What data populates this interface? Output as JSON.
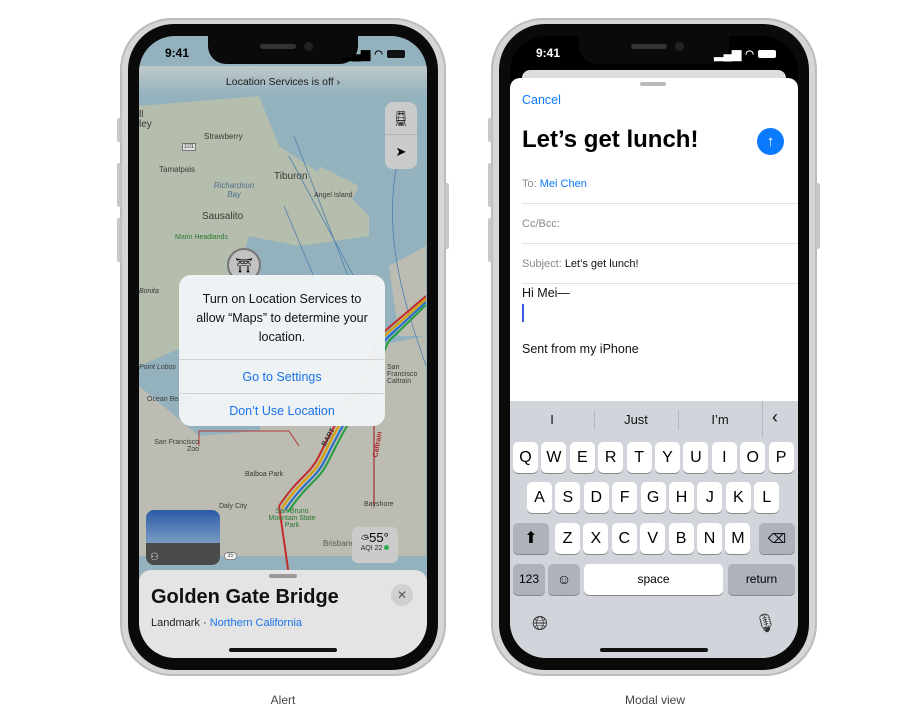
{
  "captions": {
    "left": "Alert",
    "right": "Modal view"
  },
  "status": {
    "time": "9:41"
  },
  "maps": {
    "banner": "Location Services is off",
    "labels": [
      "Strawberry",
      "101",
      "Tamalpais",
      "Tiburon",
      "Richardson Bay",
      "Angel Island",
      "Sausalito",
      "Marin Headlands",
      "Bonita",
      "Point Lobos",
      "Ocean Beach",
      "San Francisco Zoo",
      "Balboa Park",
      "Daly City",
      "San Bruno Mountain State Park",
      "Bayshore",
      "Brisbane",
      "San Francisco Caltrain",
      "BART",
      "Caltrain",
      "35",
      "ll ley"
    ],
    "alert": {
      "message": "Turn on Location Services to allow “Maps” to determine your location.",
      "primary": "Go to Settings",
      "secondary": "Don’t Use Location"
    },
    "weather": {
      "temp": "55°",
      "aqi": "AQI 22"
    },
    "place": {
      "title": "Golden Gate Bridge",
      "category": "Landmark",
      "separator": " · ",
      "region": "Northern California"
    },
    "colors": {
      "link": "#1a73e8",
      "aqi_good": "#34c759"
    }
  },
  "mail": {
    "cancel": "Cancel",
    "title": "Let’s get lunch!",
    "to_label": "To:",
    "to_value": "Mei Chen",
    "cc_label": "Cc/Bcc:",
    "subject_label": "Subject:",
    "subject_value": "Let’s get lunch!",
    "body_greeting": "Hi Mei—",
    "signature": "Sent from my iPhone",
    "accent": "#0a7aff"
  },
  "keyboard": {
    "suggestions": [
      "I",
      "Just",
      "I’m"
    ],
    "row1": [
      "Q",
      "W",
      "E",
      "R",
      "T",
      "Y",
      "U",
      "I",
      "O",
      "P"
    ],
    "row2": [
      "A",
      "S",
      "D",
      "F",
      "G",
      "H",
      "J",
      "K",
      "L"
    ],
    "row3": [
      "Z",
      "X",
      "C",
      "V",
      "B",
      "N",
      "M"
    ],
    "numbers": "123",
    "space": "space",
    "return": "return"
  }
}
